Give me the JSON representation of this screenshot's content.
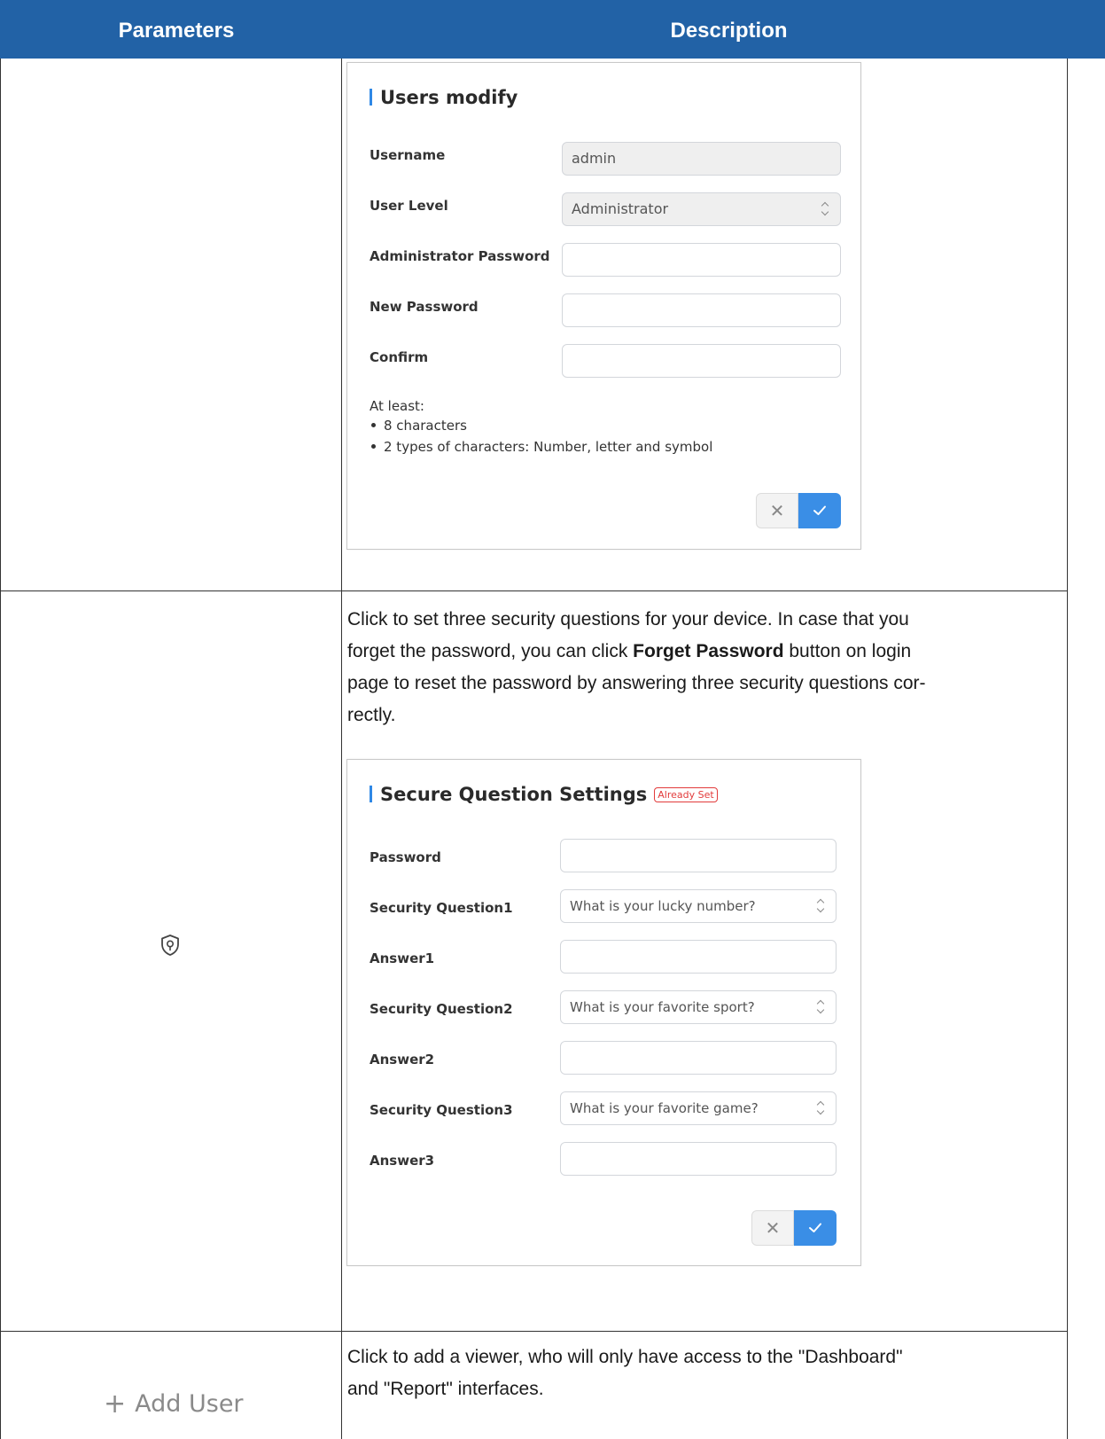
{
  "header": {
    "col1": "Parameters",
    "col2": "Description"
  },
  "users_modify": {
    "title": "Users modify",
    "fields": [
      {
        "label": "Username",
        "value": "admin"
      },
      {
        "label": "User Level",
        "value": "Administrator"
      },
      {
        "label": "Administrator Password",
        "value": ""
      },
      {
        "label": "New Password",
        "value": ""
      },
      {
        "label": "Confirm",
        "value": ""
      }
    ],
    "hint_title": "At least:",
    "hints": [
      "8 characters",
      "2 types of characters: Number, letter and symbol"
    ]
  },
  "security": {
    "desc_1": "Click to set three security questions for your device. In case that you",
    "desc_2a": "forget the password, you can click ",
    "desc_2b": "Forget Password",
    "desc_2c": " button on login",
    "desc_3": "page to reset the password by answering three security questions cor-",
    "desc_4": "rectly.",
    "icon": "shield-lock-icon",
    "panel_title": "Secure Question Settings",
    "badge": "Already Set",
    "fields": [
      {
        "label": "Password",
        "value": ""
      },
      {
        "label": "Security Question1",
        "value": "What is your lucky number?"
      },
      {
        "label": "Answer1",
        "value": ""
      },
      {
        "label": "Security Question2",
        "value": "What is your favorite sport?"
      },
      {
        "label": "Answer2",
        "value": ""
      },
      {
        "label": "Security Question3",
        "value": "What is your favorite game?"
      },
      {
        "label": "Answer3",
        "value": ""
      }
    ]
  },
  "add_user": {
    "label": "Add User",
    "icon": "plus-icon",
    "desc_1": "Click to add a viewer, who will only have access to the \"Dashboard\"",
    "desc_2": "and \"Report\" interfaces."
  },
  "colors": {
    "header_bg": "#2262a6",
    "accent": "#3a8ee6",
    "badge": "#e23b3b"
  }
}
